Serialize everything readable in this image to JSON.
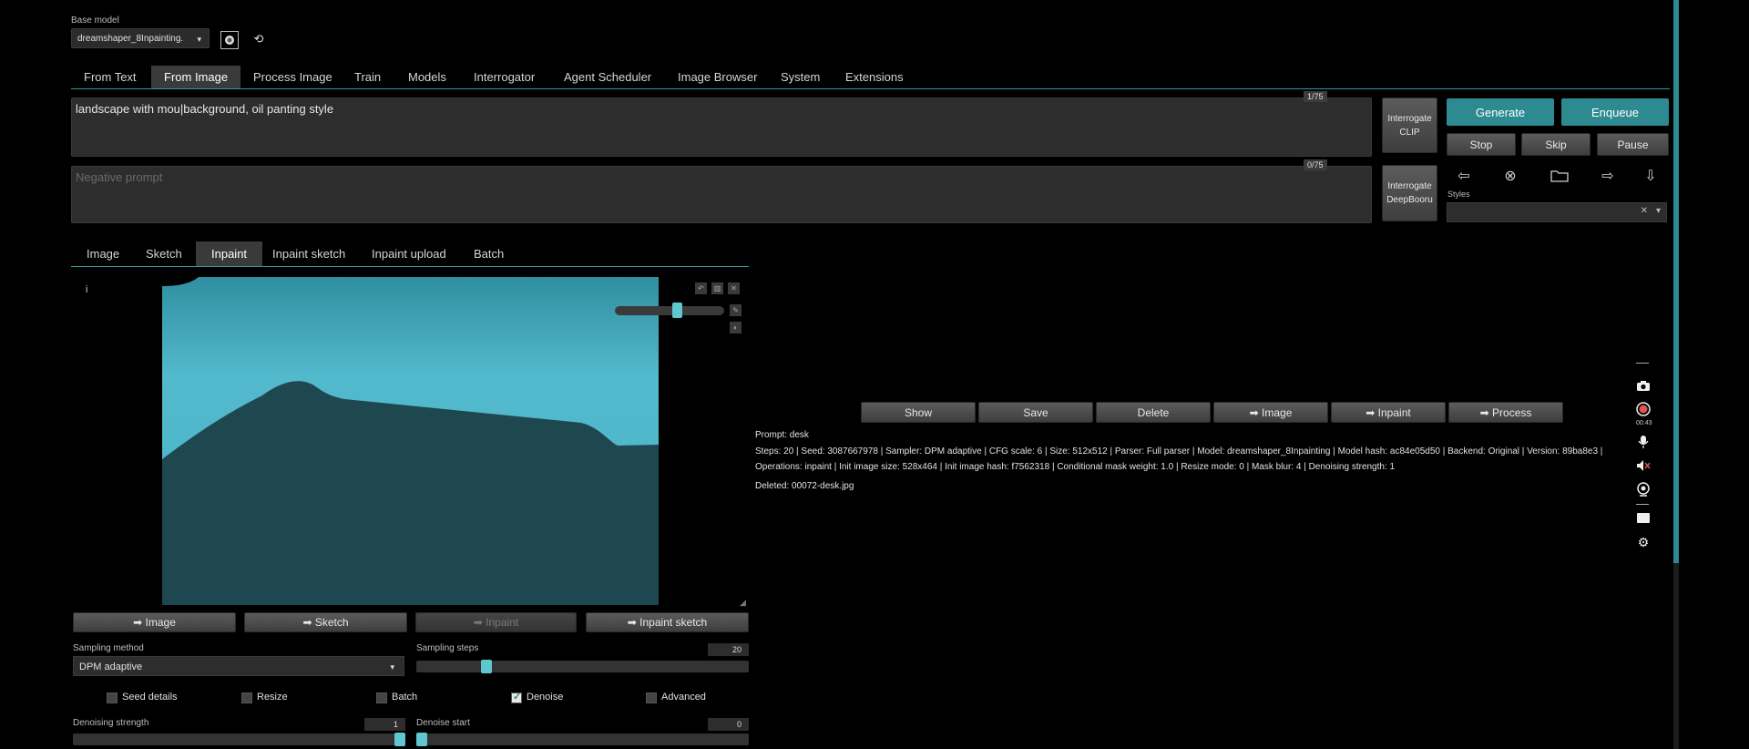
{
  "header": {
    "base_model_label": "Base model",
    "base_model_value": "dreamshaper_8Inpainting.",
    "refresh_icon": "refresh-icon",
    "model_image_icon": "image-icon"
  },
  "main_tabs": [
    "From Text",
    "From Image",
    "Process Image",
    "Train",
    "Models",
    "Interrogator",
    "Agent Scheduler",
    "Image Browser",
    "System",
    "Extensions"
  ],
  "active_main_tab": "From Image",
  "prompt": {
    "value": "landscape with mou|background, oil panting style",
    "counter": "1/75"
  },
  "negative_prompt": {
    "placeholder": "Negative prompt",
    "counter": "0/75"
  },
  "interrogate": {
    "clip": [
      "Interrogate",
      "CLIP"
    ],
    "deepbooru": [
      "Interrogate",
      "DeepBooru"
    ]
  },
  "buttons": {
    "generate": "Generate",
    "enqueue": "Enqueue",
    "stop": "Stop",
    "skip": "Skip",
    "pause": "Pause"
  },
  "tool_icons": {
    "left": "⇦",
    "clear": "⊗",
    "folder": "🗁",
    "right": "⇨",
    "down": "⇩"
  },
  "styles": {
    "label": "Styles",
    "clear": "✕",
    "caret": "▾"
  },
  "sub_tabs": [
    "Image",
    "Sketch",
    "Inpaint",
    "Inpaint sketch",
    "Inpaint upload",
    "Batch"
  ],
  "active_sub_tab": "Inpaint",
  "canvas": {
    "info_glyph": "i",
    "brush_size": 0.58
  },
  "send_buttons": [
    "➡ Image",
    "➡ Sketch",
    "➡ Inpaint",
    "➡ Inpaint sketch"
  ],
  "result_buttons": [
    "Show",
    "Save",
    "Delete",
    "➡ Image",
    "➡ Inpaint",
    "➡ Process"
  ],
  "result_info": {
    "prompt_line": "Prompt: desk",
    "params_line": "Steps: 20 | Seed: 3087667978 | Sampler: DPM adaptive | CFG scale: 6 | Size: 512x512 | Parser: Full parser | Model: dreamshaper_8Inpainting | Model hash: ac84e05d50 | Backend: Original | Version: 89ba8e3 |",
    "ops_line": "Operations: inpaint | Init image size: 528x464 | Init image hash: f7562318 | Conditional mask weight: 1.0 | Resize mode: 0 | Mask blur: 4 | Denoising strength: 1",
    "deleted_line": "Deleted: 00072-desk.jpg"
  },
  "sampling": {
    "method_label": "Sampling method",
    "method_value": "DPM adaptive",
    "steps_label": "Sampling steps",
    "steps_value": "20",
    "steps_fraction": 0.2
  },
  "checkboxes": [
    {
      "label": "Seed details",
      "checked": false
    },
    {
      "label": "Resize",
      "checked": false
    },
    {
      "label": "Batch",
      "checked": false
    },
    {
      "label": "Denoise",
      "checked": true
    },
    {
      "label": "Advanced",
      "checked": false
    }
  ],
  "denoise": {
    "strength_label": "Denoising strength",
    "strength_value": "1",
    "start_label": "Denoise start",
    "start_value": "0"
  },
  "recorder": {
    "timer": "00:43"
  },
  "colors": {
    "accent": "#2d8a90",
    "slider": "#5fc7cf",
    "sky": "#4fb7cb",
    "mask": "#1f4750"
  }
}
